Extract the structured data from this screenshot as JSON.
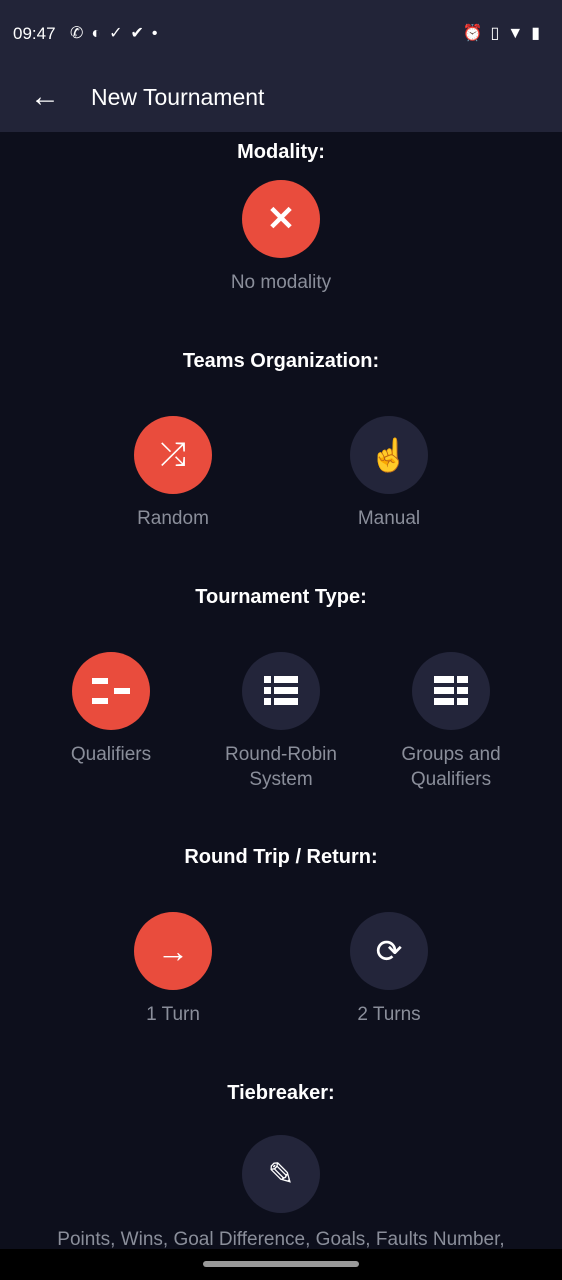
{
  "status": {
    "time": "09:47",
    "left_icons": [
      "whatsapp-icon",
      "app-icon",
      "check-circle-outline-icon",
      "check-circle-icon",
      "dot-icon"
    ],
    "right_icons": [
      "alarm-icon",
      "vibrate-icon",
      "wifi-icon",
      "battery-charging-icon"
    ]
  },
  "header": {
    "title": "New Tournament",
    "back_icon": "arrow-left-icon"
  },
  "colors": {
    "accent": "#e94c3d",
    "inactive": "#23253a",
    "background": "#0d0f1c",
    "header": "#222438"
  },
  "sections": {
    "modality": {
      "title": "Modality:",
      "options": [
        {
          "label": "No modality",
          "icon": "close-icon",
          "selected": true
        }
      ]
    },
    "teams": {
      "title": "Teams Organization:",
      "options": [
        {
          "label": "Random",
          "icon": "shuffle-icon",
          "selected": true
        },
        {
          "label": "Manual",
          "icon": "hand-pointer-icon",
          "selected": false
        }
      ]
    },
    "type": {
      "title": "Tournament Type:",
      "options": [
        {
          "label": "Qualifiers",
          "icon": "bracket-icon",
          "selected": true
        },
        {
          "label": "Round-Robin System",
          "icon": "list-icon",
          "selected": false
        },
        {
          "label": "Groups and Qualifiers",
          "icon": "grid-list-icon",
          "selected": false
        }
      ]
    },
    "round": {
      "title": "Round Trip / Return:",
      "options": [
        {
          "label": "1 Turn",
          "icon": "arrow-right-icon",
          "selected": true
        },
        {
          "label": "2 Turns",
          "icon": "sync-icon",
          "selected": false
        }
      ]
    },
    "tiebreaker": {
      "title": "Tiebreaker:",
      "icon": "pencil-icon",
      "value": "Points, Wins, Goal Difference, Goals, Faults Number,"
    }
  }
}
